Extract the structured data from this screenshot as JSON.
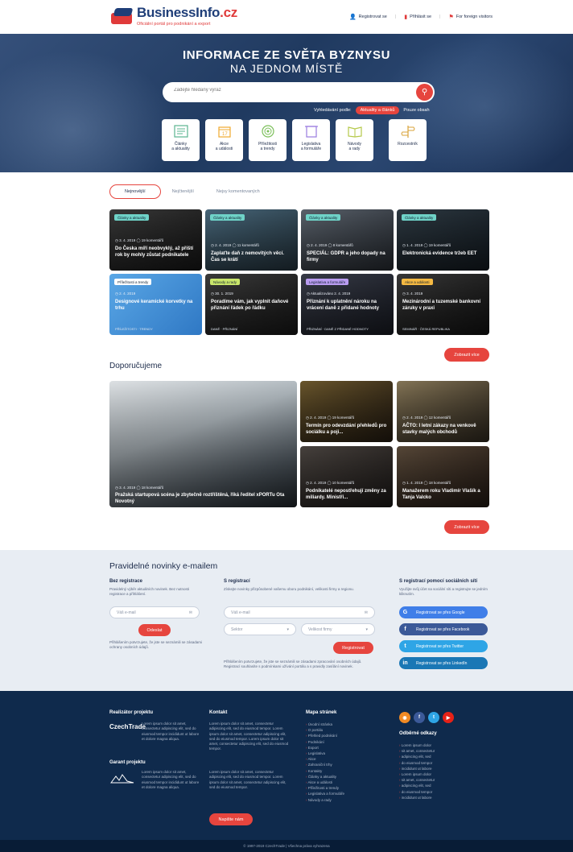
{
  "header": {
    "brand_name": "BusinessInfo",
    "brand_tld": ".cz",
    "brand_sub": "Oficiální portál pro podnikání a export",
    "links": [
      "Registrovat se",
      "Přihlásit se",
      "For foreign visitors"
    ]
  },
  "hero": {
    "title_line1": "INFORMACE ZE SVĚTA BYZNYSU",
    "title_line2": "NA JEDNOM MÍSTĚ",
    "search_placeholder": "Zadejte hledaný výraz",
    "search_by_label": "Vyhledávání podle:",
    "search_option_active": "Aktuality a článků",
    "search_option_other": "Pouze obsah",
    "tiles": [
      {
        "icon": "articles-icon",
        "label1": "Články",
        "label2": "a aktuality"
      },
      {
        "icon": "calendar-icon",
        "label1": "Akce",
        "label2": "a události"
      },
      {
        "icon": "target-icon",
        "label1": "Příležitosti",
        "label2": "a trendy"
      },
      {
        "icon": "legislation-icon",
        "label1": "Legislativa",
        "label2": "a formuláře"
      },
      {
        "icon": "book-icon",
        "label1": "Návody",
        "label2": "a rady"
      },
      {
        "icon": "signpost-icon",
        "label1": "Rozcestník",
        "label2": ""
      }
    ]
  },
  "tabs": [
    "Nejnovější",
    "Nejčtenější",
    "Nejsy komentovaných"
  ],
  "cards": [
    {
      "badge": "Články a aktuality",
      "badge_color": "#6fd3c8",
      "meta": "◷ 3. 4. 2019  ◯ 19 komentářů",
      "title": "Do Česka míří neobvyklý, až příští rok by mohly zůstat podnikatele",
      "foot": "",
      "bg": "linear-gradient(135deg,#3b3b3b,#1a1a1a)"
    },
    {
      "badge": "Články a aktuality",
      "badge_color": "#6fd3c8",
      "meta": "◷ 2. 4. 2019  ◯ 11 komentářů",
      "title": "Zaplaťte daň z nemovitých věcí. Čas se krátí",
      "foot": "",
      "bg": "linear-gradient(135deg,#4a6a7e,#2b3d48)"
    },
    {
      "badge": "Články a aktuality",
      "badge_color": "#6fd3c8",
      "meta": "◷ 2. 4. 2019  ◯ 8 komentářů",
      "title": "SPECIÁL: GDPR a jeho dopady na firmy",
      "foot": "",
      "bg": "linear-gradient(135deg,#5e6670,#2e333a)"
    },
    {
      "badge": "Články a aktuality",
      "badge_color": "#6fd3c8",
      "meta": "◷ 1. 4. 2019  ◯ 19 komentářů",
      "title": "Elektronická evidence tržeb EET",
      "foot": "",
      "bg": "linear-gradient(135deg,#2f3b44,#171f26)"
    },
    {
      "badge": "Příležitosti a trendy",
      "badge_color": "#ffffff",
      "meta": "◷ 2. 4. 2019",
      "title": "Designové keramické korvetky na trhu",
      "foot": "PŘÍLEŽITOSTI · TRENDY",
      "bg": "linear-gradient(135deg,#5aa7e6,#2f78c4)"
    },
    {
      "badge": "Návody a rady",
      "badge_color": "#c9e66b",
      "meta": "◷ 30. 1. 2019",
      "title": "Poradíme vám, jak vyplnit daňové přiznání řádek po řádku",
      "foot": "DANĚ · PŘIZNÁNÍ",
      "bg": "linear-gradient(135deg,#3d3d3d,#1c1c1c)"
    },
    {
      "badge": "Legislativa a formuláře",
      "badge_color": "#b99cf0",
      "meta": "◷ Aktualizováno 2. 4. 2019",
      "title": "Přiznání k uplatnění nároku na vrácení daně z přidané hodnoty",
      "foot": "PŘIZNÁNÍ · DANĚ Z PŘIDANÉ HODNOTY",
      "bg": "linear-gradient(135deg,#3a3e4a,#1d2029)"
    },
    {
      "badge": "Akce a události",
      "badge_color": "#f5b942",
      "meta": "◷ 3. 4. 2019",
      "title": "Mezinárodní a tuzemské bankovní záruky v praxi",
      "foot": "SEMINÁŘ · ČESKÁ REPUBLIKA",
      "bg": "linear-gradient(135deg,#3a3a3a,#161616)"
    }
  ],
  "show_more_label": "Zobrazit více",
  "recommended": {
    "title": "Doporučujeme",
    "big": {
      "meta": "◷ 3. 4. 2019  ◯ 18 komentářů",
      "title": "Pražská startupová scéna je zbytečně roztříštěná, říká ředitel xPORTu Ota Novotný"
    },
    "small": [
      {
        "meta": "◷ 2. 4. 2019  ◯ 19 komentářů",
        "title": "Termín pro odevzdání přehledů pro sociálku a poji...",
        "bg": "linear-gradient(135deg,#6f5a2e,#2a2014)"
      },
      {
        "meta": "◷ 2. 4. 2019  ◯ 12 komentářů",
        "title": "AČTO: I letní zákazy na venkově stavky malých obchodů",
        "bg": "linear-gradient(135deg,#8a7a5a,#3a3226)"
      },
      {
        "meta": "◷ 2. 4. 2019  ◯ 10 komentářů",
        "title": "Podnikatelé nepostřehují změny za miliardy. Ministři...",
        "bg": "linear-gradient(135deg,#4a4440,#221e1c)"
      },
      {
        "meta": "◷ 1. 4. 2019  ◯ 18 komentářů",
        "title": "Manažerem roku Vladimír Vlašík a Tanja Valcko",
        "bg": "linear-gradient(135deg,#5a4a3a,#2a1f18)"
      }
    ]
  },
  "newsletter": {
    "title": "Pravidelné novinky e-mailem",
    "col1_h": "Bez registrace",
    "col1_p": "Pravidelný výběr aktuálních novinek. Bez nutnosti registrace a přihlášení.",
    "col1_input": "Váš e-mail",
    "col1_btn": "Odeslat",
    "col1_note": "Přihlášením potvrzujete, že jste se seznámili se zásadami ochrany osobních údajů.",
    "col2_h": "S registrací",
    "col2_p": "Získejte novinky přizpůsobené vašemu oboru podnikání, velikosti firmy a regionu.",
    "col2_input": "Váš e-mail",
    "col2_select1": "Sektor",
    "col2_select2": "Velikost firmy",
    "col2_btn": "Registrovat",
    "col2_note": "Přihlášením potvrzujete, že jste se seznámili se zásadami zpracování osobních údajů. Registrací souhlasíte s podmínkami užívání portálu a s pravidly zasílání novinek.",
    "col3_h": "S registrací pomocí sociálních sítí",
    "col3_p": "Využijte svůj účet na sociální síti a registrujte se jedním kliknutím.",
    "social": [
      {
        "icon": "google-icon",
        "glyph": "G",
        "label": "Registrovat se přes Google",
        "color": "#3f7ee8"
      },
      {
        "icon": "facebook-icon",
        "glyph": "f",
        "label": "Registrovat se přes Facebook",
        "color": "#3b5998"
      },
      {
        "icon": "twitter-icon",
        "glyph": "t",
        "label": "Registrovat se přes Twitter",
        "color": "#2ea5e6"
      },
      {
        "icon": "linkedin-icon",
        "glyph": "in",
        "label": "Registrovat se přes LinkedIn",
        "color": "#1a77b5"
      }
    ]
  },
  "footer": {
    "col1_h": "Realizátor projektu",
    "col1_logo": "CzechTrade",
    "col1_p": "Lorem ipsum dolor sit amet, consectetur adipiscing elit, sed do eiusmod tempor incididunt ut labore et dolore magna aliqua.",
    "col1_h2": "Garant projektu",
    "col1_p2": "Lorem ipsum dolor sit amet, consectetur adipiscing elit, sed do eiusmod tempor incididunt ut labore et dolore magna aliqua.",
    "col2_h": "Kontakt",
    "col2_p": "Lorem ipsum dolor sit amet, consectetur adipiscing elit, sed do eiusmod tempor. Lorem ipsum dolor sit amet, consectetur adipiscing elit, sed do eiusmod tempor. Lorem ipsum dolor sit amet, consectetur adipiscing elit, sed do eiusmod tempor.",
    "col2_p2": "Lorem ipsum dolor sit amet, consectetur adipiscing elit, sed do eiusmod tempor. Lorem ipsum dolor sit amet, consectetur adipiscing elit, sed do eiusmod tempor.",
    "col2_btn": "Napište nám",
    "col3_h": "Mapa stránek",
    "col3_items": [
      "Úvodní stránka",
      "O portálu",
      "Přehled podnikání",
      "Podnikání",
      "Export",
      "Legislativa",
      "Akce",
      "Zahraniční trhy",
      "Kontakty",
      "Články a aktuality",
      "Akce a události",
      "Příležitosti a trendy",
      "Legislativa a formuláře",
      "Návody a rady"
    ],
    "col4_h": "Odběrné odkazy",
    "col4_items": [
      "Lorem ipsum dolor",
      "sit amet, consectetur",
      "adipiscing elit, sed",
      "do eiusmod tempor",
      "incididunt ut labore",
      "Lorem ipsum dolor",
      "sit amet, consectetur",
      "adipiscing elit, sed",
      "do eiusmod tempor",
      "incididunt ut labore"
    ],
    "social": [
      {
        "icon": "rss-icon",
        "glyph": "◉",
        "color": "#f08a24"
      },
      {
        "icon": "facebook-icon",
        "glyph": "f",
        "color": "#3b5998"
      },
      {
        "icon": "twitter-icon",
        "glyph": "t",
        "color": "#2ea5e6"
      },
      {
        "icon": "youtube-icon",
        "glyph": "▶",
        "color": "#e62117"
      }
    ],
    "copyright": "© 1997-2019 CzechTrade | Všechna práva vyhrazena"
  }
}
